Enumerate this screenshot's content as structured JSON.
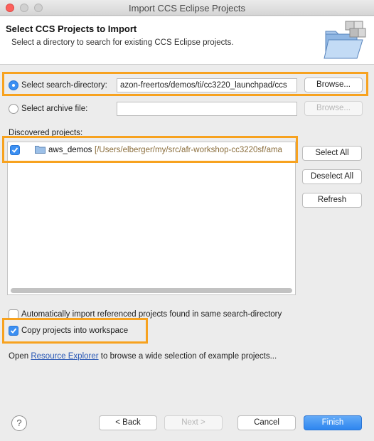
{
  "window": {
    "title": "Import CCS Eclipse Projects"
  },
  "header": {
    "title": "Select CCS Projects to Import",
    "description": "Select a directory to search for existing CCS Eclipse projects."
  },
  "search_directory": {
    "label": "Select search-directory:",
    "value": "azon-freertos/demos/ti/cc3220_launchpad/ccs",
    "browse_label": "Browse..."
  },
  "archive_file": {
    "label": "Select archive file:",
    "value": "",
    "browse_label": "Browse..."
  },
  "discovered": {
    "label": "Discovered projects:",
    "projects": [
      {
        "name": "aws_demos",
        "path": "[/Users/elberger/my/src/afr-workshop-cc3220sf/ama"
      }
    ]
  },
  "side_buttons": {
    "select_all": "Select All",
    "deselect_all": "Deselect All",
    "refresh": "Refresh"
  },
  "options": {
    "auto_import": "Automatically import referenced projects found in same search-directory",
    "copy_into_workspace": "Copy projects into workspace"
  },
  "resource_line": {
    "prefix": "Open",
    "link": "Resource Explorer",
    "suffix": "to browse a wide selection of example projects..."
  },
  "footer": {
    "help": "?",
    "back": "< Back",
    "next": "Next >",
    "cancel": "Cancel",
    "finish": "Finish"
  },
  "colors": {
    "highlight": "#f7a21f",
    "accent": "#3b8ff2",
    "link": "#2857b4"
  }
}
